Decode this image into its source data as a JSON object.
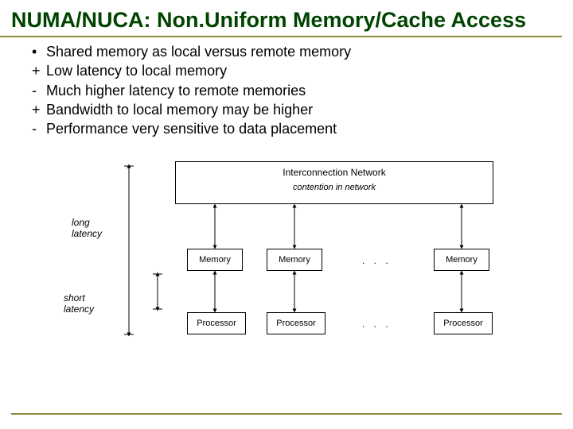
{
  "title": "NUMA/NUCA: Non.Uniform Memory/Cache Access",
  "bullets": [
    {
      "mark": "•",
      "text": "Shared memory as local versus remote memory"
    },
    {
      "mark": "+",
      "text": "Low latency to local memory"
    },
    {
      "mark": "-",
      "text": "Much higher latency to remote memories"
    },
    {
      "mark": "+",
      "text": "Bandwidth to local memory may be higher"
    },
    {
      "mark": "-",
      "text": "Performance very sensitive to data placement"
    }
  ],
  "diagram": {
    "network_title": "Interconnection Network",
    "network_sub": "contention in network",
    "memory_label": "Memory",
    "processor_label": "Processor",
    "dots": ". . .",
    "long_latency": "long latency",
    "short_latency": "short latency"
  }
}
